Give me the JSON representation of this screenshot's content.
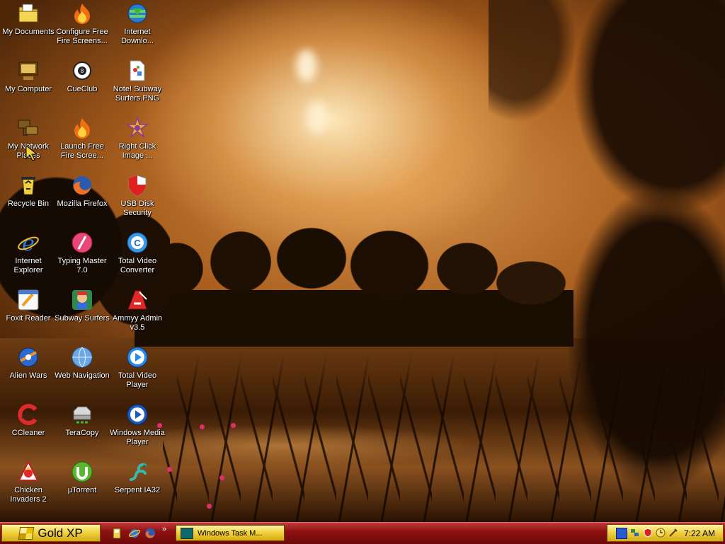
{
  "desktop": {
    "icons": [
      {
        "label": "My Documents",
        "icon": "folder-documents-icon"
      },
      {
        "label": "Configure Free Fire Screens...",
        "icon": "flame-icon"
      },
      {
        "label": "Internet Downlo...",
        "icon": "download-globe-icon"
      },
      {
        "label": "My Computer",
        "icon": "computer-icon"
      },
      {
        "label": "CueClub",
        "icon": "billiard-ball-icon"
      },
      {
        "label": "Note! Subway Surfers.PNG",
        "icon": "image-file-icon"
      },
      {
        "label": "My Network Places",
        "icon": "network-icon"
      },
      {
        "label": "Launch Free Fire Scree...",
        "icon": "flame-icon"
      },
      {
        "label": "Right Click Image ...",
        "icon": "gear-star-icon"
      },
      {
        "label": "Recycle Bin",
        "icon": "recycle-bin-icon"
      },
      {
        "label": "Mozilla Firefox",
        "icon": "firefox-icon"
      },
      {
        "label": "USB Disk Security",
        "icon": "shield-icon"
      },
      {
        "label": "Internet Explorer",
        "icon": "internet-explorer-icon"
      },
      {
        "label": "Typing Master 7.0",
        "icon": "typing-master-icon"
      },
      {
        "label": "Total Video Converter",
        "icon": "converter-icon"
      },
      {
        "label": "Foxit Reader",
        "icon": "pdf-reader-icon"
      },
      {
        "label": "Subway Surfers",
        "icon": "game-icon"
      },
      {
        "label": "Ammyy Admin v3.5",
        "icon": "remote-admin-icon"
      },
      {
        "label": "Alien Wars",
        "icon": "alien-wars-icon"
      },
      {
        "label": "Web Navigation",
        "icon": "globe-icon"
      },
      {
        "label": "Total Video Player",
        "icon": "play-icon"
      },
      {
        "label": "CCleaner",
        "icon": "ccleaner-icon"
      },
      {
        "label": "TeraCopy",
        "icon": "drive-icon"
      },
      {
        "label": "Windows Media Player",
        "icon": "media-player-icon"
      },
      {
        "label": "Chicken Invaders 2",
        "icon": "chicken-icon"
      },
      {
        "label": "µTorrent",
        "icon": "utorrent-icon"
      },
      {
        "label": "Serpent IA32",
        "icon": "serpent-icon"
      }
    ]
  },
  "taskbar": {
    "start_label": "Gold XP",
    "quick_launch": [
      {
        "icon": "show-desktop-icon"
      },
      {
        "icon": "internet-explorer-icon"
      },
      {
        "icon": "firefox-icon"
      }
    ],
    "more_label": "»",
    "tasks": [
      {
        "label": "Windows Task M...",
        "icon": "task-manager-icon"
      }
    ],
    "tray": {
      "icons": [
        "monitor-icon",
        "network-tray-icon",
        "shield-tray-icon",
        "clock-tray-icon",
        "tools-tray-icon"
      ],
      "clock": "7:22 AM"
    }
  },
  "colors": {
    "taskbar_red": "#8e1212",
    "gold": "#f2d340",
    "wallpaper_sepia": "#c07a35"
  }
}
